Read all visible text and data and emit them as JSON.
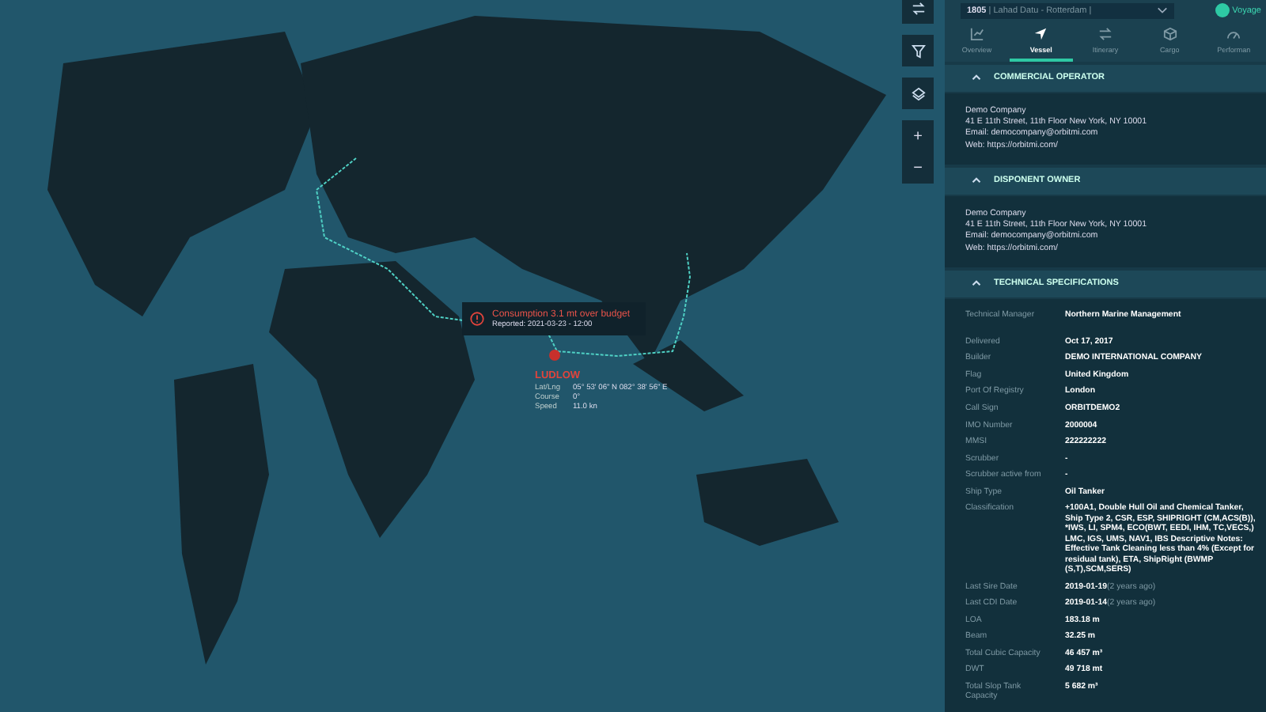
{
  "map": {
    "alert": {
      "message": "Consumption 3.1 mt over budget",
      "reported": "Reported: 2021-03-23 - 12:00"
    },
    "vessel": {
      "name": "LUDLOW",
      "fields": [
        {
          "label": "Lat/Lng",
          "value": "05° 53' 06\" N 082° 38' 56\" E"
        },
        {
          "label": "Course",
          "value": "0°"
        },
        {
          "label": "Speed",
          "value": "11.0 kn"
        }
      ]
    },
    "zoom_in": "+",
    "zoom_out": "−"
  },
  "header": {
    "voyage": "1805",
    "route": "| Lahad Datu - Rotterdam |",
    "toggle": {
      "label": "Voyage",
      "on": true
    }
  },
  "tabs": [
    {
      "label": "Overview",
      "selected": false
    },
    {
      "label": "Vessel",
      "selected": true
    },
    {
      "label": "Itinerary",
      "selected": false
    },
    {
      "label": "Cargo",
      "selected": false
    },
    {
      "label": "Performan",
      "selected": false
    }
  ],
  "sections": [
    {
      "title": "COMMERCIAL OPERATOR",
      "expanded": true,
      "kind": "contact",
      "lines": [
        "Demo Company",
        "41 E 11th Street, 11th Floor New York, NY 10001",
        "Email: democompany@orbitmi.com",
        "Web: https://orbitmi.com/"
      ]
    },
    {
      "title": "DISPONENT OWNER",
      "expanded": true,
      "kind": "contact",
      "lines": [
        "Demo Company",
        "41 E 11th Street, 11th Floor New York, NY 10001",
        "Email: democompany@orbitmi.com",
        "Web: https://orbitmi.com/"
      ]
    },
    {
      "title": "TECHNICAL SPECIFICATIONS",
      "expanded": true,
      "kind": "specs",
      "manager": {
        "label": "Technical Manager",
        "value": "Northern Marine Management"
      },
      "rows": [
        {
          "label": "Delivered",
          "value": "Oct 17, 2017"
        },
        {
          "label": "Builder",
          "value": "DEMO INTERNATIONAL COMPANY"
        },
        {
          "label": "Flag",
          "value": "United Kingdom"
        },
        {
          "label": "Port Of Registry",
          "value": "London"
        },
        {
          "label": "Call Sign",
          "value": "ORBITDEMO2"
        },
        {
          "label": "IMO Number",
          "value": "2000004"
        },
        {
          "label": "MMSI",
          "value": "222222222"
        },
        {
          "label": "Scrubber",
          "value": "-"
        },
        {
          "label": "Scrubber active from",
          "value": "-"
        },
        {
          "label": "Ship Type",
          "value": "Oil Tanker"
        },
        {
          "label": "Classification",
          "value": "+100A1, Double Hull Oil and Chemical Tanker, Ship Type 2, CSR, ESP, SHIPRIGHT (CM,ACS(B)), *IWS, LI, SPM4, ECO(BWT, EEDI, IHM, TC,VECS,) LMC, IGS, UMS, NAV1, IBS Descriptive Notes: Effective Tank Cleaning less than 4% (Except for residual tank), ETA, ShipRight (BWMP (S,T),SCM,SERS)"
        },
        {
          "label": "Last Sire Date",
          "value": "2019-01-19",
          "note": "(2 years ago)"
        },
        {
          "label": "Last CDI Date",
          "value": "2019-01-14",
          "note": "(2 years ago)"
        },
        {
          "label": "LOA",
          "value": "183.18 m"
        },
        {
          "label": "Beam",
          "value": "32.25 m"
        },
        {
          "label": "Total Cubic Capacity",
          "value": "46 457 m³"
        },
        {
          "label": "DWT",
          "value": "49 718 mt"
        },
        {
          "label": "Total Slop Tank Capacity",
          "value": "5 682 m³"
        }
      ]
    }
  ]
}
